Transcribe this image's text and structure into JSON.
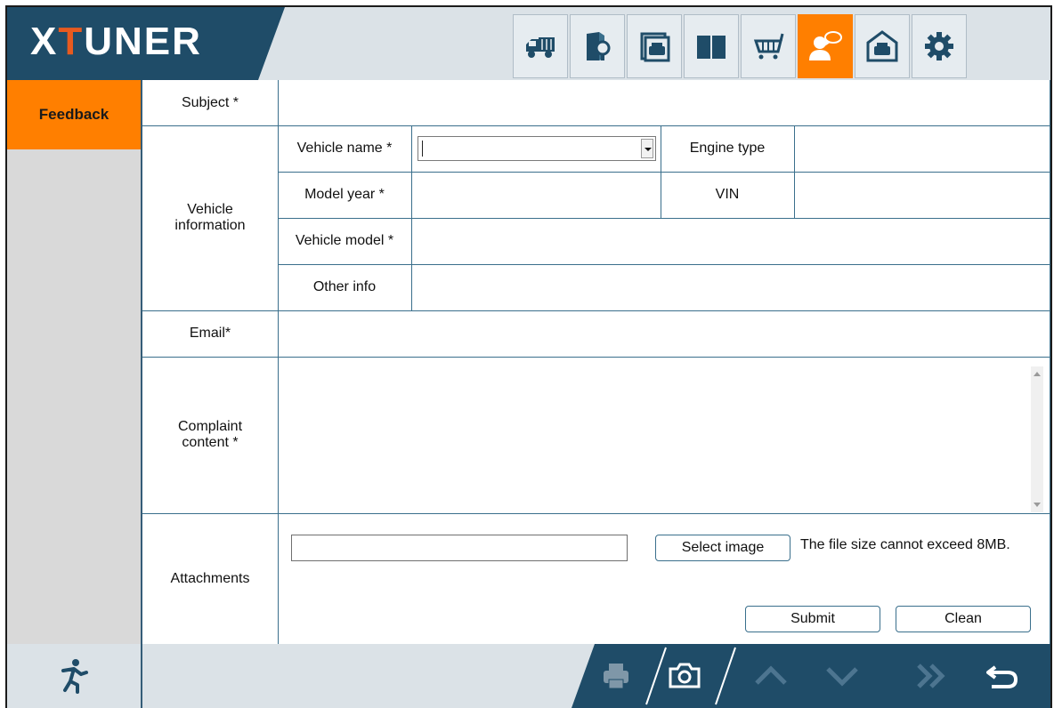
{
  "header": {
    "logo": "XTUNER",
    "toolbar": [
      {
        "name": "truck-icon",
        "active": false
      },
      {
        "name": "book-search-icon",
        "active": false
      },
      {
        "name": "gallery-icon",
        "active": false
      },
      {
        "name": "manual-book-icon",
        "active": false
      },
      {
        "name": "cart-icon",
        "active": false
      },
      {
        "name": "feedback-user-icon",
        "active": true
      },
      {
        "name": "garage-icon",
        "active": false
      },
      {
        "name": "gear-icon",
        "active": false
      }
    ],
    "accent_color": "#ff7f00",
    "bar_color": "#1f4c68"
  },
  "sidebar": {
    "tabs": [
      {
        "label": "Feedback",
        "active": true
      }
    ]
  },
  "form": {
    "subject_label": "Subject *",
    "vehicle_information_label": "Vehicle information",
    "vehicle_name_label": "Vehicle name *",
    "vehicle_name_value": "",
    "engine_type_label": "Engine type",
    "model_year_label": "Model year *",
    "vin_label": "VIN",
    "vehicle_model_label": "Vehicle model *",
    "other_info_label": "Other info",
    "email_label": "Email*",
    "complaint_label": "Complaint content *",
    "attachments_label": "Attachments",
    "select_image_label": "Select image",
    "file_note": "The file size cannot exceed 8MB.",
    "submit_label": "Submit",
    "clean_label": "Clean"
  },
  "footer": {
    "buttons": [
      "exit-icon",
      "print-icon",
      "camera-icon",
      "page-up-icon",
      "page-down-icon",
      "fast-forward-icon",
      "back-icon"
    ]
  }
}
